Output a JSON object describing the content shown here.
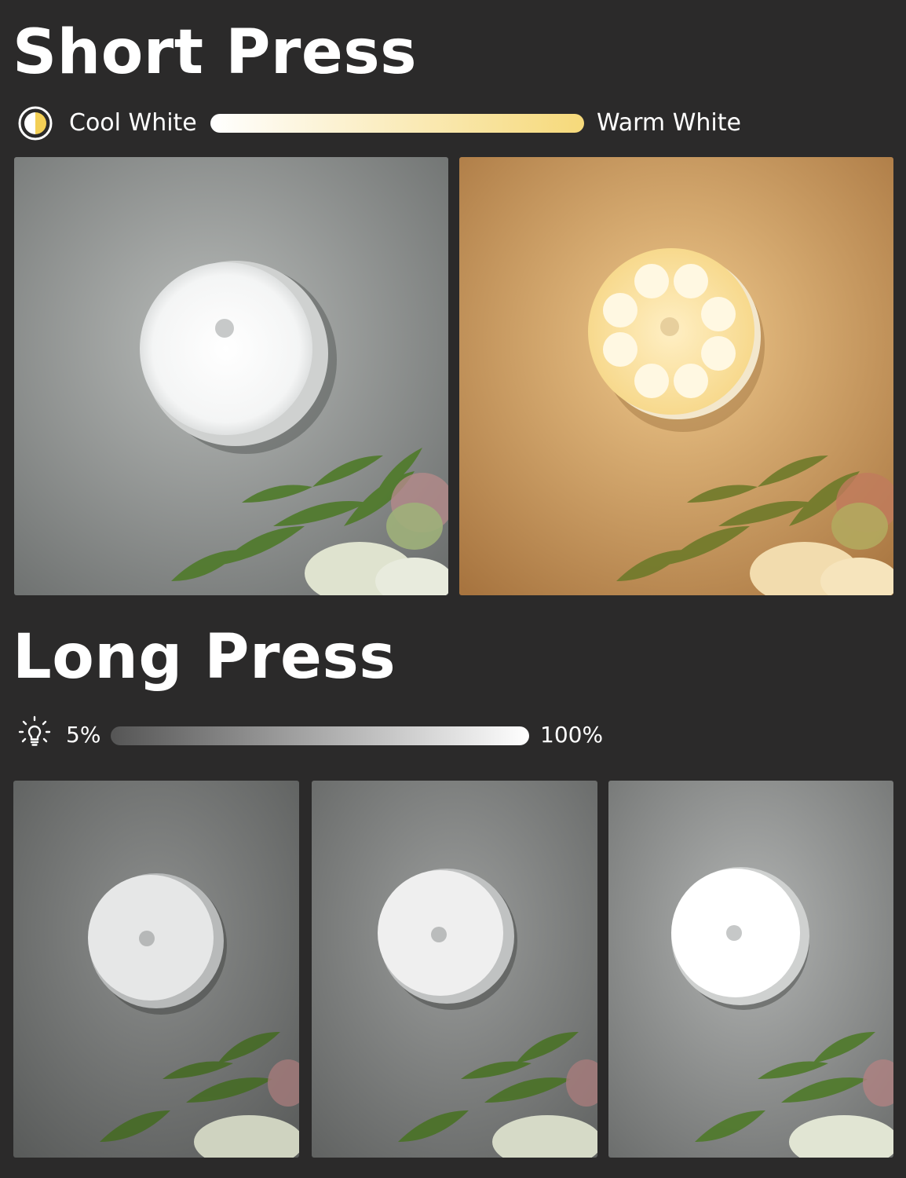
{
  "short_press": {
    "title": "Short Press",
    "icon": "half-circle-color-temperature-icon",
    "left_label": "Cool White",
    "right_label": "Warm White",
    "bar_colors": [
      "#ffffff",
      "#f6d97a"
    ],
    "photos": [
      {
        "name": "cool-white-light-photo",
        "wall": "#8d8f8e",
        "light": "#ffffff"
      },
      {
        "name": "warm-white-light-photo",
        "wall": "#c89a5e",
        "light": "#fff2c2"
      }
    ]
  },
  "long_press": {
    "title": "Long Press",
    "icon": "lightbulb-brightness-icon",
    "left_label": "5%",
    "right_label": "100%",
    "bar_colors": [
      "#555555",
      "#ffffff"
    ],
    "photos": [
      {
        "name": "brightness-low-photo",
        "wall": "#6f7170",
        "light": "#eeeeee"
      },
      {
        "name": "brightness-medium-photo",
        "wall": "#7a7c7b",
        "light": "#f5f5f5"
      },
      {
        "name": "brightness-high-photo",
        "wall": "#8a8c8b",
        "light": "#ffffff"
      }
    ]
  }
}
